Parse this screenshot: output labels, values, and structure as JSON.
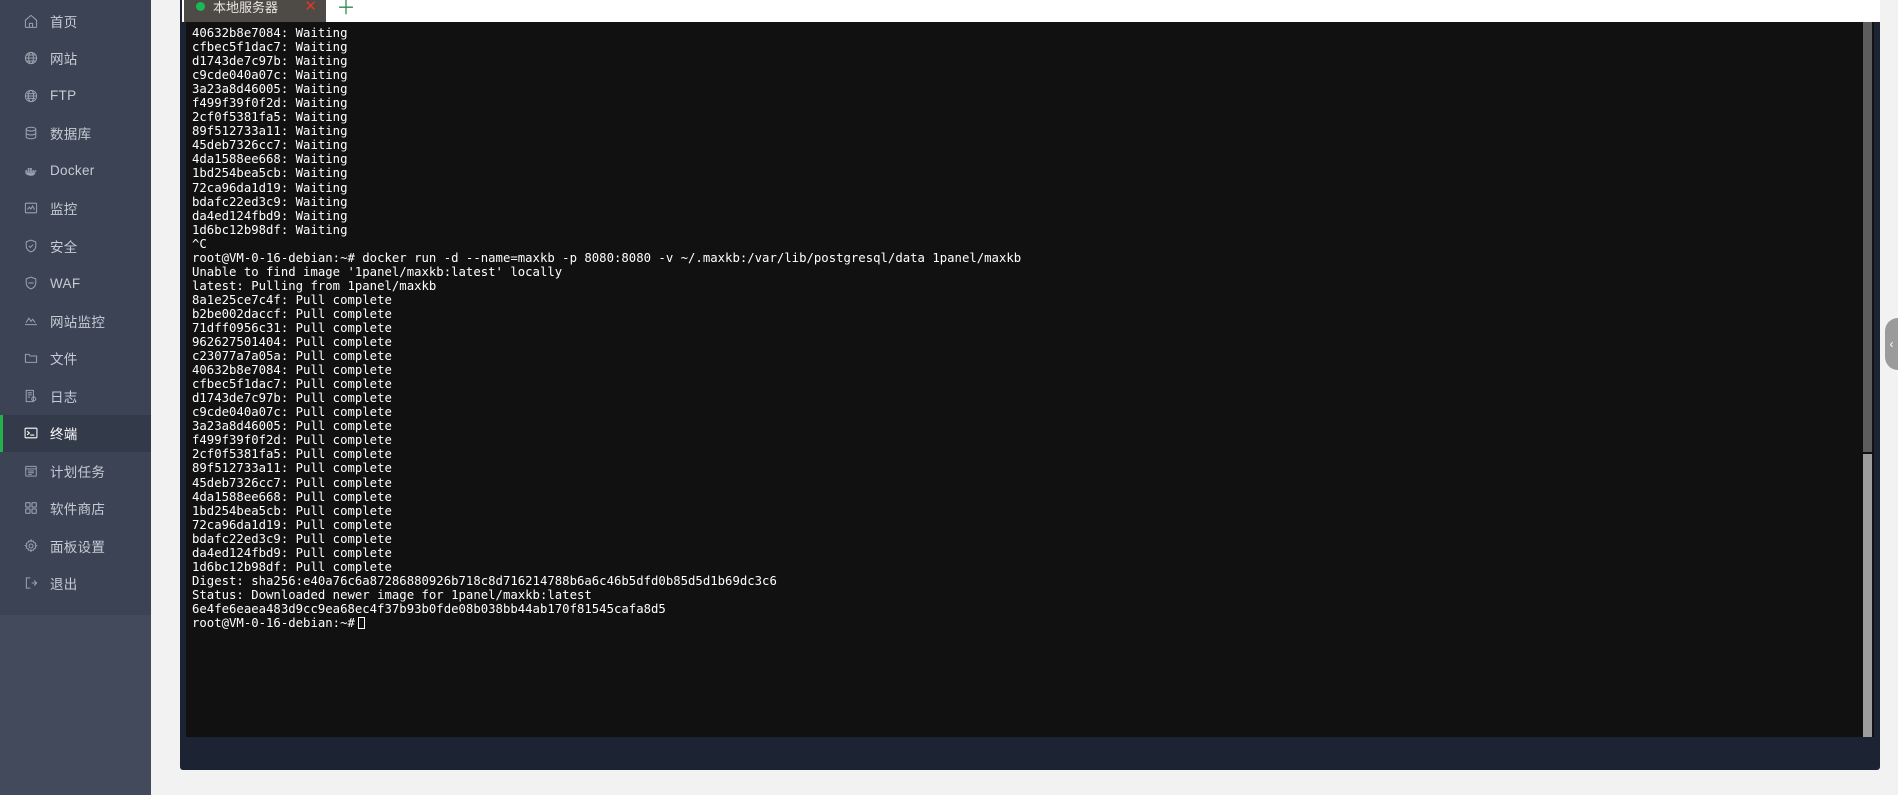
{
  "sidebar": {
    "items": [
      {
        "label": "首页",
        "icon": "home-icon",
        "name": "sidebar-item-home",
        "active": false
      },
      {
        "label": "网站",
        "icon": "globe-icon",
        "name": "sidebar-item-website",
        "active": false
      },
      {
        "label": "FTP",
        "icon": "ftp-icon",
        "name": "sidebar-item-ftp",
        "active": false
      },
      {
        "label": "数据库",
        "icon": "database-icon",
        "name": "sidebar-item-database",
        "active": false
      },
      {
        "label": "Docker",
        "icon": "docker-icon",
        "name": "sidebar-item-docker",
        "active": false
      },
      {
        "label": "监控",
        "icon": "monitor-icon",
        "name": "sidebar-item-monitor",
        "active": false
      },
      {
        "label": "安全",
        "icon": "shield-icon",
        "name": "sidebar-item-security",
        "active": false
      },
      {
        "label": "WAF",
        "icon": "waf-shield-icon",
        "name": "sidebar-item-waf",
        "active": false
      },
      {
        "label": "网站监控",
        "icon": "chart-line-icon",
        "name": "sidebar-item-site-monitor",
        "active": false
      },
      {
        "label": "文件",
        "icon": "folder-icon",
        "name": "sidebar-item-files",
        "active": false
      },
      {
        "label": "日志",
        "icon": "log-icon",
        "name": "sidebar-item-logs",
        "active": false
      },
      {
        "label": "终端",
        "icon": "terminal-icon",
        "name": "sidebar-item-terminal",
        "active": true
      },
      {
        "label": "计划任务",
        "icon": "calendar-icon",
        "name": "sidebar-item-cron",
        "active": false
      },
      {
        "label": "软件商店",
        "icon": "appstore-icon",
        "name": "sidebar-item-appstore",
        "active": false
      },
      {
        "label": "面板设置",
        "icon": "gear-icon",
        "name": "sidebar-item-settings",
        "active": false
      },
      {
        "label": "退出",
        "icon": "logout-icon",
        "name": "sidebar-item-logout",
        "active": false
      }
    ],
    "accent_color": "#22b14c",
    "background_color": "#3b4354",
    "active_background_color": "#333a49"
  },
  "terminal": {
    "tab": {
      "title": "本地服务器",
      "status_color": "#19b955",
      "close_label": "✕"
    },
    "add_tab_label": "＋",
    "fullscreen_label": "fullscreen-icon",
    "collapse_label": "‹",
    "background_color": "#111111",
    "foreground_color": "#ffffff",
    "lines": [
      "40632b8e7084: Waiting",
      "cfbec5f1dac7: Waiting",
      "d1743de7c97b: Waiting",
      "c9cde040a07c: Waiting",
      "3a23a8d46005: Waiting",
      "f499f39f0f2d: Waiting",
      "2cf0f5381fa5: Waiting",
      "89f512733a11: Waiting",
      "45deb7326cc7: Waiting",
      "4da1588ee668: Waiting",
      "1bd254bea5cb: Waiting",
      "72ca96da1d19: Waiting",
      "bdafc22ed3c9: Waiting",
      "da4ed124fbd9: Waiting",
      "1d6bc12b98df: Waiting",
      "^C",
      "root@VM-0-16-debian:~# docker run -d --name=maxkb -p 8080:8080 -v ~/.maxkb:/var/lib/postgresql/data 1panel/maxkb",
      "Unable to find image '1panel/maxkb:latest' locally",
      "latest: Pulling from 1panel/maxkb",
      "8a1e25ce7c4f: Pull complete",
      "b2be002daccf: Pull complete",
      "71dff0956c31: Pull complete",
      "962627501404: Pull complete",
      "c23077a7a05a: Pull complete",
      "40632b8e7084: Pull complete",
      "cfbec5f1dac7: Pull complete",
      "d1743de7c97b: Pull complete",
      "c9cde040a07c: Pull complete",
      "3a23a8d46005: Pull complete",
      "f499f39f0f2d: Pull complete",
      "2cf0f5381fa5: Pull complete",
      "89f512733a11: Pull complete",
      "45deb7326cc7: Pull complete",
      "4da1588ee668: Pull complete",
      "1bd254bea5cb: Pull complete",
      "72ca96da1d19: Pull complete",
      "bdafc22ed3c9: Pull complete",
      "da4ed124fbd9: Pull complete",
      "1d6bc12b98df: Pull complete",
      "Digest: sha256:e40a76c6a87286880926b718c8d716214788b6a6c46b5dfd0b85d5d1b69dc3c6",
      "Status: Downloaded newer image for 1panel/maxkb:latest",
      "6e4fe6eaea483d9cc9ea68ec4f37b93b0fde08b038bb44ab170f81545cafa8d5"
    ],
    "prompt": "root@VM-0-16-debian:~#"
  }
}
